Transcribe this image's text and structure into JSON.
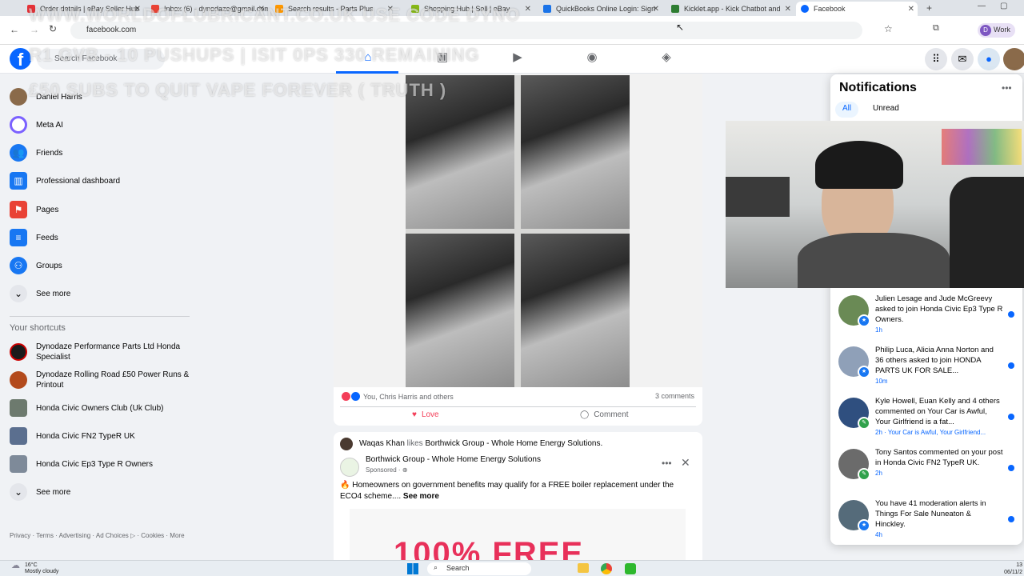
{
  "browser": {
    "tabs": [
      {
        "label": "Order details | eBay Seller Hub",
        "color": "#e53238",
        "active": false
      },
      {
        "label": "Inbox (6) - dynodaze@gmail.com",
        "color": "#ea4335",
        "active": false
      },
      {
        "label": "Search results - Parts Plus",
        "color": "#ff9800",
        "active": false
      },
      {
        "label": "Shopping Hub | Sell | eBay",
        "color": "#86b817",
        "active": false
      },
      {
        "label": "QuickBooks Online Login: Sign",
        "color": "#1a73e8",
        "active": false
      },
      {
        "label": "Kicklet.app - Kick Chatbot and",
        "color": "#2e7d32",
        "active": false
      },
      {
        "label": "Facebook",
        "color": "#0866ff",
        "active": true
      }
    ],
    "url": "facebook.com",
    "profile_label": "Work"
  },
  "fb": {
    "search_placeholder": "Search Facebook",
    "logo": "f"
  },
  "sidebar": {
    "profile_name": "Daniel Harris",
    "items": [
      {
        "label": "Meta AI",
        "icon": "meta-ai-icon",
        "color": "#7b61ff"
      },
      {
        "label": "Friends",
        "icon": "friends-icon",
        "color": "#1877f2"
      },
      {
        "label": "Professional dashboard",
        "icon": "dashboard-icon",
        "color": "#1877f2"
      },
      {
        "label": "Pages",
        "icon": "flag-icon",
        "color": "#e94235"
      },
      {
        "label": "Feeds",
        "icon": "feeds-icon",
        "color": "#1877f2"
      },
      {
        "label": "Groups",
        "icon": "groups-icon",
        "color": "#1877f2"
      }
    ],
    "see_more": "See more",
    "shortcuts_title": "Your shortcuts",
    "shortcuts": [
      {
        "label": "Dynodaze Performance Parts Ltd Honda Specialist",
        "color": "#1b1b1b"
      },
      {
        "label": "Dynodaze Rolling Road £50 Power Runs & Printout",
        "color": "#b34a1c"
      },
      {
        "label": "Honda Civic Owners Club (Uk Club)",
        "color": "#6d7a6e"
      },
      {
        "label": "Honda Civic FN2 TypeR UK",
        "color": "#5b6f8f"
      },
      {
        "label": "Honda Civic Ep3 Type R Owners",
        "color": "#7e8a99"
      }
    ],
    "see_more_2": "See more",
    "footer": "Privacy · Terms · Advertising · Ad Choices ▷ · Cookies · More"
  },
  "post1": {
    "reactions_text": "You, Chris Harris and others",
    "comments": "3 comments",
    "love_label": "Love",
    "comment_label": "Comment"
  },
  "post2": {
    "liker": "Waqas Khan",
    "likes_word": "likes",
    "liked_page": "Borthwick Group - Whole Home Energy Solutions.",
    "page_name": "Borthwick Group - Whole Home Energy Solutions",
    "sponsored": "Sponsored",
    "body": "Homeowners on government benefits may qualify for a FREE boiler replacement under the ECO4 scheme....",
    "see_more": "See more",
    "banner_text": "100% FREE"
  },
  "notifications": {
    "title": "Notifications",
    "tab_all": "All",
    "tab_unread": "Unread",
    "items": [
      {
        "text": "Julien Lesage and Jude McGreevy asked to join Honda Civic Ep3 Type R Owners.",
        "time": "1h",
        "avatar": "#6a8a55",
        "badge": "#1877f2"
      },
      {
        "text": "Philip Luca, Alicia Anna Norton and 36 others asked to join HONDA PARTS UK FOR SALE...",
        "time": "10m",
        "avatar": "#8fa0b8",
        "badge": "#1877f2"
      },
      {
        "text": "Kyle Howell, Euan Kelly and 4 others commented on Your Car is Awful, Your Girlfriend is a fat...",
        "time": "2h · Your Car is Awful, Your Girlfriend...",
        "avatar": "#2f4f7f",
        "badge": "#31a24c"
      },
      {
        "text": "Tony Santos commented on your post in Honda Civic FN2 TypeR UK.",
        "time": "2h",
        "avatar": "#6b6b6b",
        "badge": "#31a24c"
      },
      {
        "text": "You have 41 moderation alerts in Things For Sale Nuneaton & Hinckley.",
        "time": "4h",
        "avatar": "#556b7a",
        "badge": "#1877f2"
      }
    ]
  },
  "watermark": {
    "line1": "WWW.WORLDOFLUBRICANT.CO.UK USE CODE DYNO",
    "line2": "R1 GVB - 10 PUSHUPS | ISIT 0PS 330 REMAINING",
    "line3": "£50 SUBS TO QUIT VAPE FOREVER ( TRUTH )"
  },
  "taskbar": {
    "temp": "16°C",
    "weather": "Mostly cloudy",
    "search": "Search",
    "time": "13",
    "date": "06/11/2"
  }
}
